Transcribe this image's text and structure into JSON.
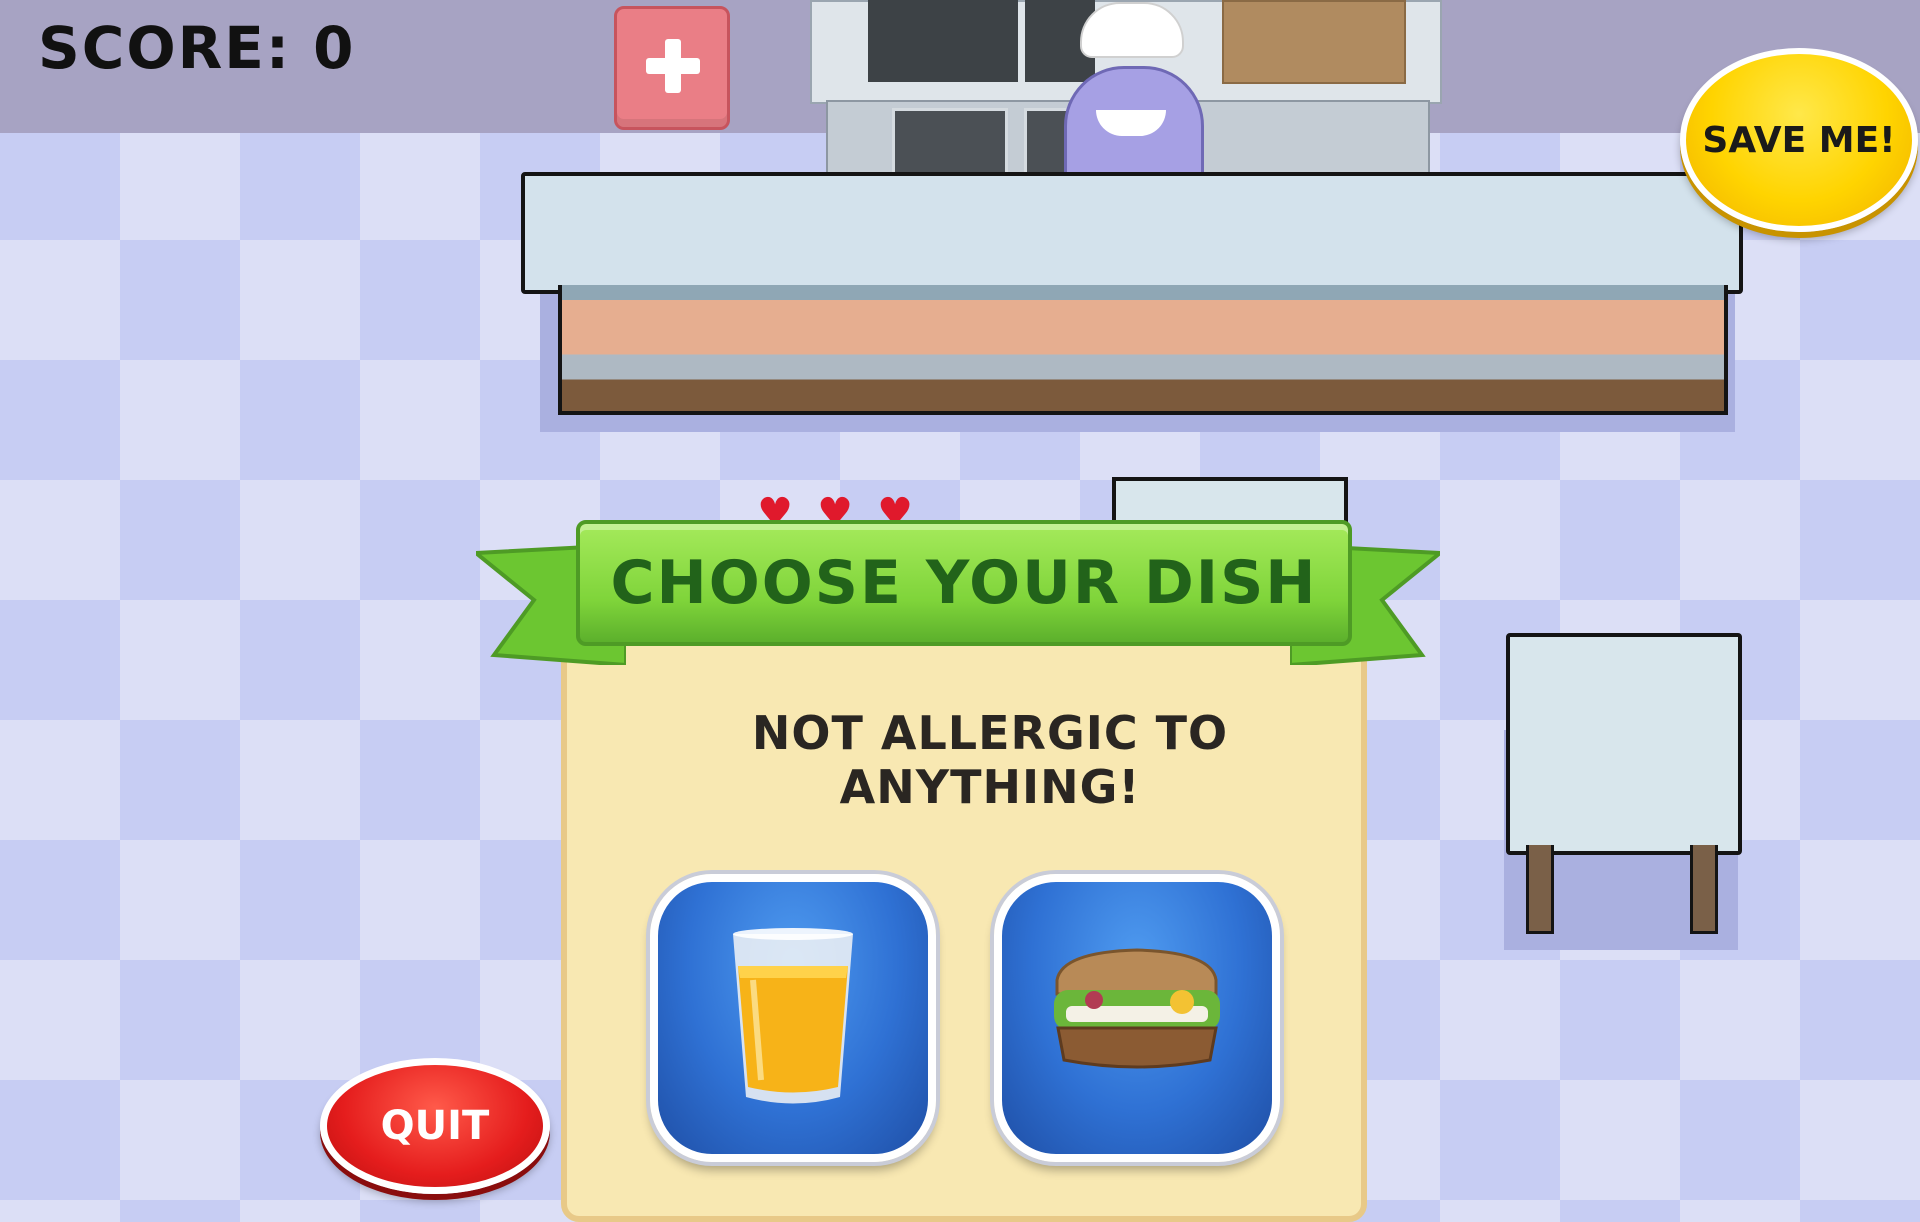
{
  "hud": {
    "score_label": "SCORE:",
    "score_value": "0",
    "lives_count": 3
  },
  "buttons": {
    "save_me_label": "SAVE ME!",
    "quit_label": "QUIT"
  },
  "dialog": {
    "title": "CHOOSE YOUR DISH",
    "subtitle_line1": "NOT ALLERGIC TO",
    "subtitle_line2": "ANYTHING!",
    "options": [
      {
        "name": "orange-juice",
        "icon": "orange-juice-glass"
      },
      {
        "name": "sandwich",
        "icon": "sandwich"
      }
    ]
  },
  "colors": {
    "ribbon_green": "#7fd43a",
    "dish_blue": "#2f71d4",
    "save_yellow": "#ffd400",
    "quit_red": "#e51d1d",
    "heart_red": "#e0192c"
  }
}
